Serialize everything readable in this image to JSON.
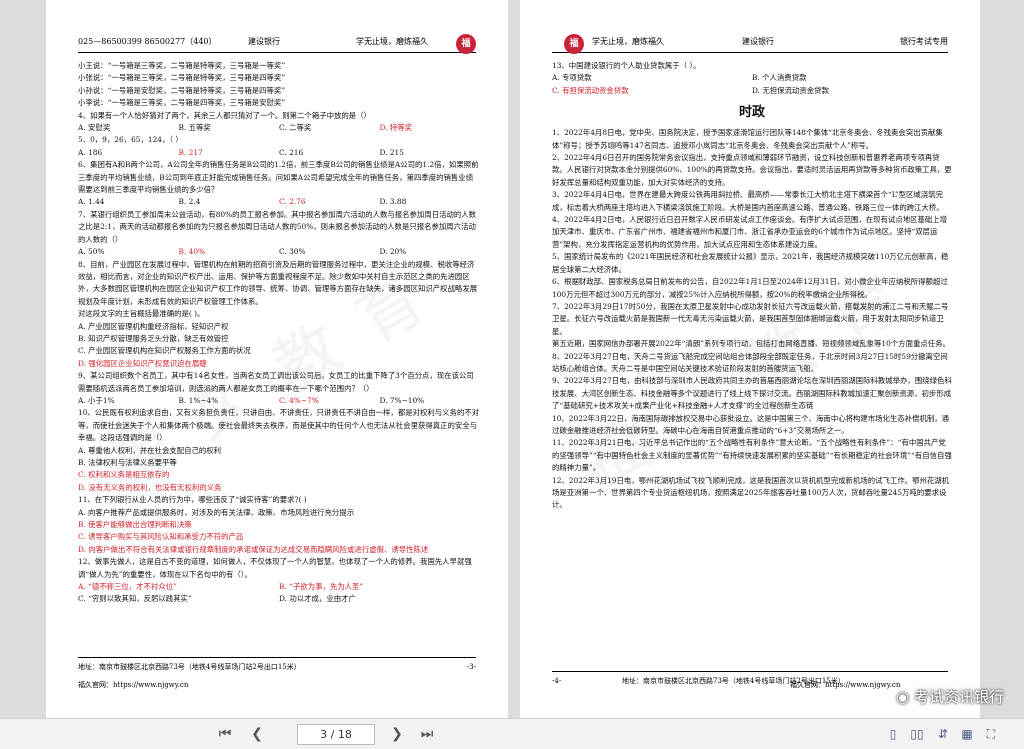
{
  "left_page": {
    "header_phone": "025—86500399 86500277（440）",
    "header_center": "建设银行",
    "header_right": "学无止境，磨炼福久",
    "seal": "福",
    "lines": [
      {
        "t": "小王说：“一号箱是三等奖，二号箱是特等奖，三号箱是一等奖”",
        "c": ""
      },
      {
        "t": "小张说：“一号箱是三等奖，二号箱是特等奖，三号箱是四等奖”",
        "c": ""
      },
      {
        "t": "小孙说：“一号箱是安慰奖，二号箱是特等奖，三号箱是四等奖”",
        "c": ""
      },
      {
        "t": "小李说：“一号箱是三等奖，二号箱是四等奖，三号箱是安慰奖”",
        "c": ""
      },
      {
        "t": "4、如果有一个人恰好猜对了两个，其余三人都只猜对了一个。则第二个箱子中放的是（）",
        "c": ""
      }
    ],
    "q4_opts": [
      "A. 安慰奖",
      "B. 五等奖",
      "C. 二等奖",
      "D. 特等奖"
    ],
    "q5": "5、0，9，26，65，124，（ ）",
    "q5_opts": [
      "A. 186",
      "B. 217",
      "C. 216",
      "D. 215"
    ],
    "q6": "6、集团有A和B两个公司，A公司全年的销售任务是B公司的1.2倍，前三季度B公司的销售业绩是A公司的1.2倍，如果照前三季度的平均销售业绩，B公司到年底正好能完成销售任务。问如果A公司希望完成全年的销售任务，第四季度的销售业绩需要达到前三季度平均销售业绩的多少倍？",
    "q6_opts": [
      "A. 1.44",
      "B. 2.4",
      "C. 2.76",
      "D. 3.88"
    ],
    "q7": "7、某银行组织员工参加周末公益活动，有80%的员工报名参加。其中报名参加周六活动的人数与报名参加周日活动的人数之比是2:1，两天的活动都报名参加的为只报名参加周日活动人数的50%，则未报名参加活动的人数是只报名参加周六活动的人数的（）",
    "q7_opts": [
      "A. 50%",
      "B. 40%",
      "C. 30%",
      "D. 20%"
    ],
    "q8": "8、目前，产业园区在发展过程中，管理机构在前期的招商引资及后期的管理服务过程中，更关注企业的规模、税收等经济效益，相比而言，对企业的知识产权产出、运用、保护等方面重视程度不足。除少数如中关村自主示范区之类的先进园区外，大多数园区管理机构在园区企业知识产权工作的领导、统筹、协调、管理等方面存在缺失，诸多园区知识产权战略发展规划及年度计划，未形成有效的知识产权管理工作体系。",
    "q8_ask": "对这段文字的主旨概括最准确的是( )。",
    "q8_opts": [
      {
        "t": "A. 产业园区管理机构重经济指标，轻知识产权",
        "c": ""
      },
      {
        "t": "B. 知识产权管理服务乏头分散，缺乏有效管控",
        "c": ""
      },
      {
        "t": "C. 产业园区管理机构在知识产权服务工作方面的状况",
        "c": ""
      },
      {
        "t": "D. 强化园区企业知识产权意识迫在眉睫",
        "c": "red"
      }
    ],
    "q9": "9、某公司组织数个名员工，其中有14名女性，当两名女员工调出该公司后，女员工的比重下降了3个百分点，现在该公司需要随机选派两名员工参加培训，则选派的两人都是女员工的概率在一下哪个范围内？（）",
    "q9_opts": [
      "A. 小于1%",
      "B. 1%~4%",
      "C. 4%~7%",
      "D. 7%~10%"
    ],
    "q10": "10、公民既有权利追求自由，又有义务担负责任，只讲自由、不讲责任，只讲责任不讲自由一样，都是对权利与义务的不对等，而使社会迷失于个人和集体两个极端。使社会最终失去秩序，而是使其中的任何个人也无法从社会里获得真正的安全与幸福。这段话强调的是（）",
    "q10_opts": [
      {
        "t": "A. 尊重他人权利，并在社会支配自己的权利",
        "c": ""
      },
      {
        "t": "B. 法律权利与法律义务要平等",
        "c": ""
      },
      {
        "t": "C. 权利和义务是相互依存的",
        "c": "red"
      },
      {
        "t": "D. 没有无义务的权利，也没有无权利的义务",
        "c": "red"
      }
    ],
    "q11": "11、在下列银行从业人员的行为中，哪些违反了“诚实待客”的要求?( )",
    "q11_opts": [
      {
        "t": "A. 向客户推荐产品或提供服务时，对涉及的有关法律、政策、市场风险进行充分提示",
        "c": ""
      },
      {
        "t": "B. 使客户能够做出合理判断和决策",
        "c": "red"
      },
      {
        "t": "C. 诱导客户购买与其风险认知和承受力不符的产品",
        "c": "red"
      },
      {
        "t": "D. 向客户做出不符合有关法律或银行规章制度的承诺或保证为达成交易而隐瞒风险或进行虚假、诱导性陈述",
        "c": "red"
      }
    ],
    "q12": "12、做事先做人，这是自古不变的道理，如何做人，不仅体现了一个人的智慧，也体现了一个人的修养。我国先人早就强调“做人为先”的重要性，体现在以下名句中的有（）。",
    "q12_opts": [
      {
        "t": "A. “德不称三位，才不衬众位”",
        "c": "red"
      },
      {
        "t": "B. “子欲为事，先为人圣”",
        "c": "red"
      },
      {
        "t": "C. “穷则以致其知，反躬以践其实”",
        "c": ""
      },
      {
        "t": "D. 功以才成，业由才广",
        "c": ""
      }
    ],
    "footer_address": "地址：南京市鼓楼区北京西路73号（地铁4号线草场门站2号出口15米）",
    "page_number": "-3-",
    "footer_site": "福久官网：https://www.njgwy.cn"
  },
  "right_page": {
    "header_left": "学无止境，磨炼福久",
    "header_center": "建设银行",
    "header_right": "银行考试专用",
    "seal": "福",
    "q13": "13、中国建设银行的个人助业贷款属于（ ）。",
    "q13_opts": [
      {
        "t": "A. 专项贷款",
        "c": ""
      },
      {
        "t": "B. 个人消费贷款",
        "c": ""
      },
      {
        "t": "C. 有担保流动资金贷款",
        "c": "red"
      },
      {
        "t": "D. 无担保流动资金贷款",
        "c": ""
      }
    ],
    "section_title": "时政",
    "news": [
      "1、2022年4月8日电，党中央、国务院决定，授予国家速滑馆运行团队等148个集体“北京冬奥会、冬残奥会突出贡献集体”称号；授予苏翊鸣等147名同志、追授邓小岚同志“北京冬奥会、冬残奥会突出贡献个人”称号。",
      "2、2022年4月6日召开的国务院常务会议指出，支持重点领域和薄弱环节融资，设立科技创新和普惠养老两项专项再贷款。人民银行对贷款本金分别提供60%、100%的再贷款支持。会议指出，要适时灵活运用再贷款等多种货币政策工具，更好发挥总量和结构双重功能，加大对实体经济的支持。",
      "3、2022年4月4日电，世界在建最大跨度公铁两用斜拉桥、最高桥——常泰长江大桥北主塔下横梁首个“L”型区域浇筑完成，标志着大桥两座主塔均进入下横梁浇筑施工阶段。大桥是国内首座高速公路、普通公路、铁路三位一体的跨江大桥。",
      "4、2022年4月2日电，人民银行近日召开数字人民币研发试点工作座谈会。有序扩大试点范围，在现有试点地区基础上增加天津市、重庆市、广东省广州市、福建省福州市和厦门市、浙江省承办亚运会的6个城市作为试点地区。坚持“双层运营”架构，充分发挥指定运营机构的优势作用，加大试点应用和生态体系建设力度。",
      "5、国家统计局发布的《2021年国民经济和社会发展统计公报》显示，2021年，我国经济规模突破110万亿元创新高，稳居全球第二大经济体。",
      "6、根据财政部、国家税务总局日前发布的公告，自2022年1月1日至2024年12月31日，对小微企业年应纳税所得额超过100万元但不超过300万元的部分，减按25%计入应纳税所得额，按20%的税率缴纳企业所得税。",
      "7、2022年3月29日17时50分，我国在太原卫星发射中心成功发射长征六号改运载火箭，搭载发射的浦江二号和天鲲二号卫星。长征六号改运载火箭是我国新一代无毒无污染运载火箭，是我国首型固体捆绑运载火箭，用于发射太阳同步轨道卫星。",
      "第五近期，国家网信办部署开展2022年“清朗”系列专项行动，包括打击网络直播、短视频领域乱象等10个方面重点任务。",
      "8、2022年3月27日电，天舟二号货运飞船完成空间站组合体部段全部既定任务，于北京时间3月27日15时59分撤离空间站核心舱组合体。天舟二号是中国空间站关键技术验证阶段发射的首艘货运飞船。",
      "9、2022年3月27日电，由科技部与深圳市人民政府共同主办的首届西丽湖论坛在深圳西丽湖国际科教城举办，围绕绿色科技发展、大湾区创新生态、科技金融等多个议题进行了线上线下探讨交流。西丽湖国际科教城加速汇聚创新资源，初步形成了“基础研究+技术攻关+成果产业化+科技金融+人才支撑”的全过程创新生态链",
      "10、2022年3月22日，海南国际碳排放权交易中心获批设立。这是中国第三个、海南中心将构建市场化生态补偿机制，通过碳金融推进经济社会低碳转型。海碳中心在海南自贸港重点推动的“6+3”交易场所之一。",
      "11、2022年3月21日电，习近平总书记作出的“五个战略性有利条件”意大论断。“五个战略性有利条件”：“有中国共产党的坚强领导”“有中国特色社会主义制度的显著优势”“有持续快速发展积累的坚实基础”“有长期稳定的社会环境”“有自信自强的精神力量”。",
      "12、2022年3月19日电，鄂州花湖机场试飞校飞顺利完成，这是我国首次以货机机型完成新机场的试飞工作。鄂州花湖机场是亚洲第一个、世界第四个专业货运枢纽机场，按照满足2025年旅客吞吐量100万人次，货邮吞吐量245万吨的要求设计。"
    ],
    "footer_address": "地址：南京市鼓楼区北京西路73号（地铁4号线草场门站2号出口15米）",
    "page_number": "-4-",
    "footer_site": "福久官网：https://www.njgwy.cn"
  },
  "toolbar": {
    "page_indicator": "3 / 18",
    "first_icon": "first-page-icon",
    "prev_icon": "prev-page-icon",
    "next_icon": "next-page-icon",
    "last_icon": "last-page-icon"
  },
  "overlay": {
    "wechat_label": "考试资讯银行"
  },
  "colors": {
    "answer_red": "#d0202a",
    "seal_red": "#c8243a",
    "background": "#dcdcdc"
  }
}
